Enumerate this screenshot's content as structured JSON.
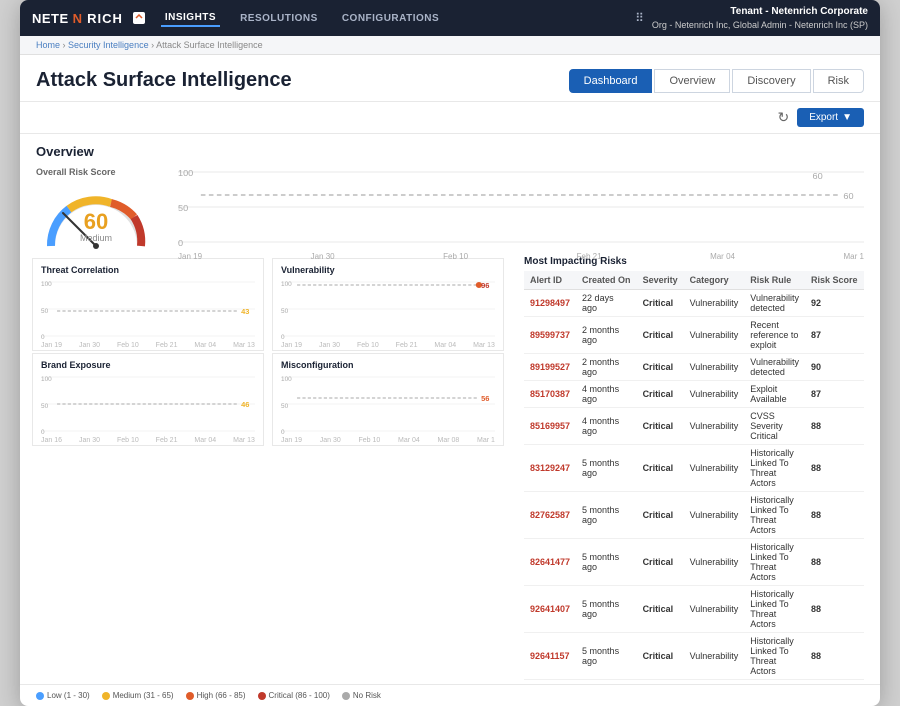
{
  "app": {
    "logo": "NETEN RICH",
    "nav_links": [
      "INSIGHTS",
      "RESOLUTIONS",
      "CONFIGURATIONS"
    ]
  },
  "tenant": {
    "label": "Tenant - Netenrich Corporate",
    "sub": "Org - Netenrich Inc, Global Admin - Netenrich Inc (SP)"
  },
  "breadcrumb": {
    "home": "Home",
    "security": "Security Intelligence",
    "current": "Attack Surface Intelligence"
  },
  "page": {
    "title": "Attack Surface Intelligence"
  },
  "tabs": [
    "Dashboard",
    "Overview",
    "Discovery",
    "Risk"
  ],
  "active_tab": "Dashboard",
  "toolbar": {
    "export_label": "Export"
  },
  "overview": {
    "label": "Overview",
    "gauge": {
      "label": "Overall Risk Score",
      "value": 60,
      "level": "Medium"
    },
    "timeline_x": [
      "Jan 19",
      "Jan 30",
      "Feb 10",
      "Feb 21",
      "Mar 04",
      "Mar 1"
    ],
    "timeline_y": [
      0,
      50,
      100
    ],
    "score_line": 60
  },
  "threat_chart": {
    "title": "Threat Correlation",
    "score": 43,
    "y_labels": [
      0,
      50,
      100
    ],
    "x_labels": [
      "Jan 19",
      "Jan 30",
      "Feb 10",
      "Feb 21",
      "Mar 04",
      "Mar 13"
    ]
  },
  "vulnerability_chart": {
    "title": "Vulnerability",
    "score": 96,
    "y_labels": [
      0,
      50,
      100
    ],
    "x_labels": [
      "Jan 19",
      "Jan 30",
      "Feb 10",
      "Feb 21",
      "Mar 04",
      "Mar 13"
    ]
  },
  "brand_chart": {
    "title": "Brand Exposure",
    "score": 46,
    "y_labels": [
      0,
      50,
      100
    ],
    "x_labels": [
      "Jan 16",
      "Jan 30",
      "Feb 10",
      "Feb 21",
      "Mar 04",
      "Mar 13"
    ]
  },
  "misconfig_chart": {
    "title": "Misconfiguration",
    "score": 56,
    "y_labels": [
      0,
      50,
      100
    ],
    "x_labels": [
      "Jan 19",
      "Jan 30",
      "Feb 10",
      "Mar 04",
      "Mar 08",
      "Mar 1"
    ]
  },
  "most_impacting": {
    "title": "Most Impacting Risks",
    "columns": [
      "Alert ID",
      "Created On",
      "Severity",
      "Category",
      "Risk Rule",
      "Risk Score"
    ],
    "rows": [
      {
        "alert_id": "91298497",
        "created": "22 days ago",
        "severity": "Critical",
        "category": "Vulnerability",
        "rule": "Vulnerability detected",
        "score": 92
      },
      {
        "alert_id": "89599737",
        "created": "2 months ago",
        "severity": "Critical",
        "category": "Vulnerability",
        "rule": "Recent reference to exploit",
        "score": 87
      },
      {
        "alert_id": "89199527",
        "created": "2 months ago",
        "severity": "Critical",
        "category": "Vulnerability",
        "rule": "Vulnerability detected",
        "score": 90
      },
      {
        "alert_id": "85170387",
        "created": "4 months ago",
        "severity": "Critical",
        "category": "Vulnerability",
        "rule": "Exploit Available",
        "score": 87
      },
      {
        "alert_id": "85169957",
        "created": "4 months ago",
        "severity": "Critical",
        "category": "Vulnerability",
        "rule": "CVSS Severity Critical",
        "score": 88
      },
      {
        "alert_id": "83129247",
        "created": "5 months ago",
        "severity": "Critical",
        "category": "Vulnerability",
        "rule": "Historically Linked To Threat Actors",
        "score": 88
      },
      {
        "alert_id": "82762587",
        "created": "5 months ago",
        "severity": "Critical",
        "category": "Vulnerability",
        "rule": "Historically Linked To Threat Actors",
        "score": 88
      },
      {
        "alert_id": "82641477",
        "created": "5 months ago",
        "severity": "Critical",
        "category": "Vulnerability",
        "rule": "Historically Linked To Threat Actors",
        "score": 88
      },
      {
        "alert_id": "92641407",
        "created": "5 months ago",
        "severity": "Critical",
        "category": "Vulnerability",
        "rule": "Historically Linked To Threat Actors",
        "score": 88
      },
      {
        "alert_id": "92641157",
        "created": "5 months ago",
        "severity": "Critical",
        "category": "Vulnerability",
        "rule": "Historically Linked To Threat Actors",
        "score": 88
      }
    ]
  },
  "legend": [
    {
      "label": "Low (1 - 30)",
      "color": "#4a9eff"
    },
    {
      "label": "Medium (31 - 65)",
      "color": "#f0b429"
    },
    {
      "label": "High (66 - 85)",
      "color": "#e05c2a"
    },
    {
      "label": "Critical (86 - 100)",
      "color": "#c0392b"
    },
    {
      "label": "No Risk",
      "color": "#aaa"
    }
  ]
}
